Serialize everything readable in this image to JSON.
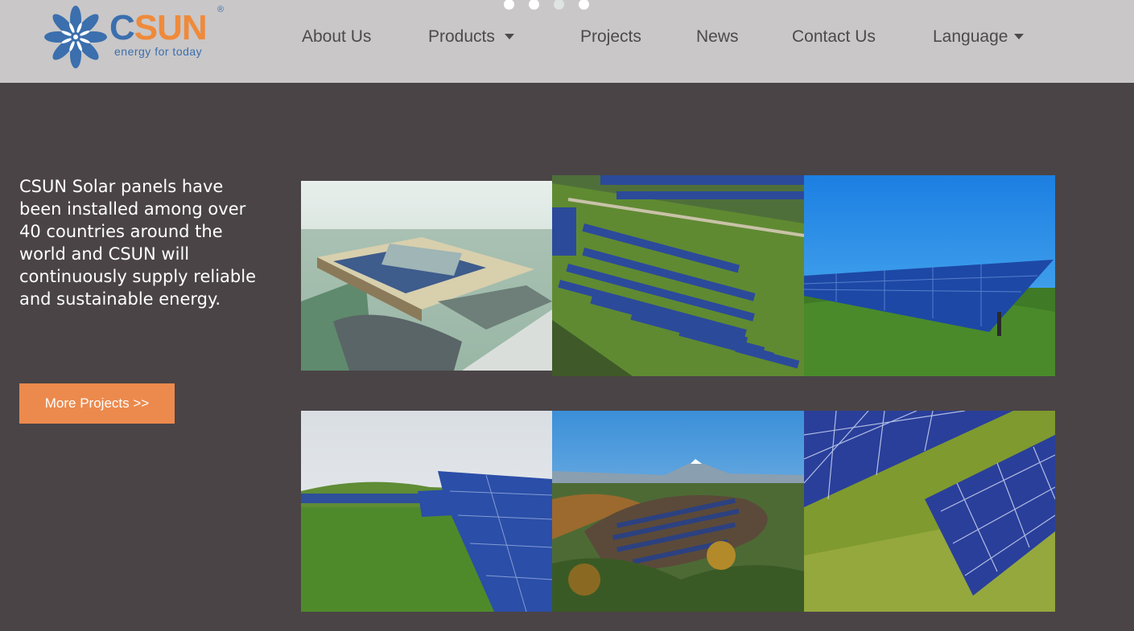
{
  "brand": {
    "name_first": "C",
    "name_rest": "SUN",
    "registered": "®",
    "tagline": "energy for today"
  },
  "carousel": {
    "slides": 4,
    "active": 2
  },
  "nav": {
    "about": "About Us",
    "products": "Products",
    "projects": "Projects",
    "news": "News",
    "contact": "Contact Us",
    "language": "Language"
  },
  "intro": {
    "text": "CSUN Solar panels have been installed among over 40 countries around the world and CSUN will continuously supply reliable and sustainable energy."
  },
  "cta": {
    "label": "More Projects >>"
  },
  "colors": {
    "header_bg": "#c9c7c8",
    "page_bg": "#4a4446",
    "accent": "#ec8a4d",
    "brand_blue": "#3b6fad",
    "brand_orange": "#ef8a3a"
  },
  "projects": [
    {
      "name": "project-airport-rooftop"
    },
    {
      "name": "project-hillside-field"
    },
    {
      "name": "project-ground-array-bluesky"
    },
    {
      "name": "project-grassland-array"
    },
    {
      "name": "project-mountain-valley"
    },
    {
      "name": "project-panel-closeup"
    }
  ]
}
